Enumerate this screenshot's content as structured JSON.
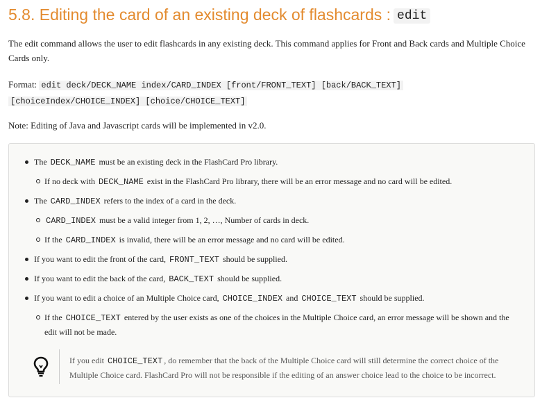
{
  "heading": {
    "text": "5.8. Editing the card of an existing deck of flashcards :",
    "code": "edit"
  },
  "intro": "The edit command allows the user to edit flashcards in any existing deck. This command applies for Front and Back cards and Multiple Choice Cards only.",
  "format": {
    "label": "Format:",
    "line1": "edit deck/DECK_NAME index/CARD_INDEX [front/FRONT_TEXT] [back/BACK_TEXT]",
    "line2": "[choiceIndex/CHOICE_INDEX] [choice/CHOICE_TEXT]"
  },
  "note": "Note: Editing of Java and Javascript cards will be implemented in v2.0.",
  "items": {
    "i1": {
      "a": "The",
      "c": "DECK_NAME",
      "b": "must be an existing deck in the FlashCard Pro library."
    },
    "i1s1": {
      "a": "If no deck with",
      "c": "DECK_NAME",
      "b": "exist in the FlashCard Pro library, there will be an error message and no card will be edited."
    },
    "i2": {
      "a": "The",
      "c": "CARD_INDEX",
      "b": "refers to the index of a card in the deck."
    },
    "i2s1": {
      "c": "CARD_INDEX",
      "b": "must be a valid integer from 1, 2, …, Number of cards in deck."
    },
    "i2s2": {
      "a": "If the",
      "c": "CARD_INDEX",
      "b": "is invalid, there will be an error message and no card will be edited."
    },
    "i3": {
      "a": "If you want to edit the front of the card,",
      "c": "FRONT_TEXT",
      "b": "should be supplied."
    },
    "i4": {
      "a": "If you want to edit the back of the card,",
      "c": "BACK_TEXT",
      "b": "should be supplied."
    },
    "i5": {
      "a": "If you want to edit a choice of an Multiple Choice card,",
      "c1": "CHOICE_INDEX",
      "m": "and",
      "c2": "CHOICE_TEXT",
      "b": "should be supplied."
    },
    "i5s1": {
      "a": "If the",
      "c": "CHOICE_TEXT",
      "b": "entered by the user exists as one of the choices in the Multiple Choice card, an error message will be shown and the",
      "b2": "edit will not be made."
    }
  },
  "tip": {
    "icon": "lightbulb-icon",
    "a": "If you edit",
    "c": "CHOICE_TEXT",
    "b": ", do remember that the back of the Multiple Choice card will still determine the correct choice of the",
    "line2": "Multiple Choice card. FlashCard Pro will not be responsible if the editing of an answer choice lead to the choice to be incorrect."
  },
  "colors": {
    "heading": "#e38b2f",
    "box_bg": "#f9f9f7",
    "box_border": "#dcdcdc"
  }
}
